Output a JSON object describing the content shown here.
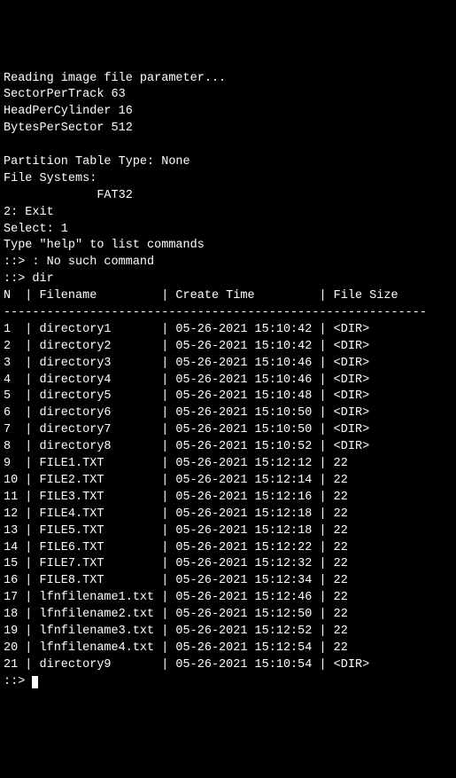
{
  "pre": {
    "reading": "Reading image file parameter...",
    "spt": "SectorPerTrack 63",
    "hpc": "HeadPerCylinder 16",
    "bps": "BytesPerSector 512",
    "ptt": "Partition Table Type: None",
    "fs_label": "File Systems:",
    "fs_val": "             FAT32",
    "exit_opt": "2: Exit",
    "select": "Select: 1",
    "help": "Type \"help\" to list commands",
    "nosuch": "::> : No such command",
    "dir_cmd": "::> dir"
  },
  "header": {
    "n": "N",
    "filename": "Filename",
    "createtime": "Create Time",
    "filesize": "File Size"
  },
  "separator": "-----------------------------------------------------------",
  "rows": [
    {
      "n": "1",
      "name": "directory1",
      "time": "05-26-2021 15:10:42",
      "size": "<DIR>"
    },
    {
      "n": "2",
      "name": "directory2",
      "time": "05-26-2021 15:10:42",
      "size": "<DIR>"
    },
    {
      "n": "3",
      "name": "directory3",
      "time": "05-26-2021 15:10:46",
      "size": "<DIR>"
    },
    {
      "n": "4",
      "name": "directory4",
      "time": "05-26-2021 15:10:46",
      "size": "<DIR>"
    },
    {
      "n": "5",
      "name": "directory5",
      "time": "05-26-2021 15:10:48",
      "size": "<DIR>"
    },
    {
      "n": "6",
      "name": "directory6",
      "time": "05-26-2021 15:10:50",
      "size": "<DIR>"
    },
    {
      "n": "7",
      "name": "directory7",
      "time": "05-26-2021 15:10:50",
      "size": "<DIR>"
    },
    {
      "n": "8",
      "name": "directory8",
      "time": "05-26-2021 15:10:52",
      "size": "<DIR>"
    },
    {
      "n": "9",
      "name": "FILE1.TXT",
      "time": "05-26-2021 15:12:12",
      "size": "22"
    },
    {
      "n": "10",
      "name": "FILE2.TXT",
      "time": "05-26-2021 15:12:14",
      "size": "22"
    },
    {
      "n": "11",
      "name": "FILE3.TXT",
      "time": "05-26-2021 15:12:16",
      "size": "22"
    },
    {
      "n": "12",
      "name": "FILE4.TXT",
      "time": "05-26-2021 15:12:18",
      "size": "22"
    },
    {
      "n": "13",
      "name": "FILE5.TXT",
      "time": "05-26-2021 15:12:18",
      "size": "22"
    },
    {
      "n": "14",
      "name": "FILE6.TXT",
      "time": "05-26-2021 15:12:22",
      "size": "22"
    },
    {
      "n": "15",
      "name": "FILE7.TXT",
      "time": "05-26-2021 15:12:32",
      "size": "22"
    },
    {
      "n": "16",
      "name": "FILE8.TXT",
      "time": "05-26-2021 15:12:34",
      "size": "22"
    },
    {
      "n": "17",
      "name": "lfnfilename1.txt",
      "time": "05-26-2021 15:12:46",
      "size": "22"
    },
    {
      "n": "18",
      "name": "lfnfilename2.txt",
      "time": "05-26-2021 15:12:50",
      "size": "22"
    },
    {
      "n": "19",
      "name": "lfnfilename3.txt",
      "time": "05-26-2021 15:12:52",
      "size": "22"
    },
    {
      "n": "20",
      "name": "lfnfilename4.txt",
      "time": "05-26-2021 15:12:54",
      "size": "22"
    },
    {
      "n": "21",
      "name": "directory9",
      "time": "05-26-2021 15:10:54",
      "size": "<DIR>"
    }
  ],
  "prompt": "::> "
}
